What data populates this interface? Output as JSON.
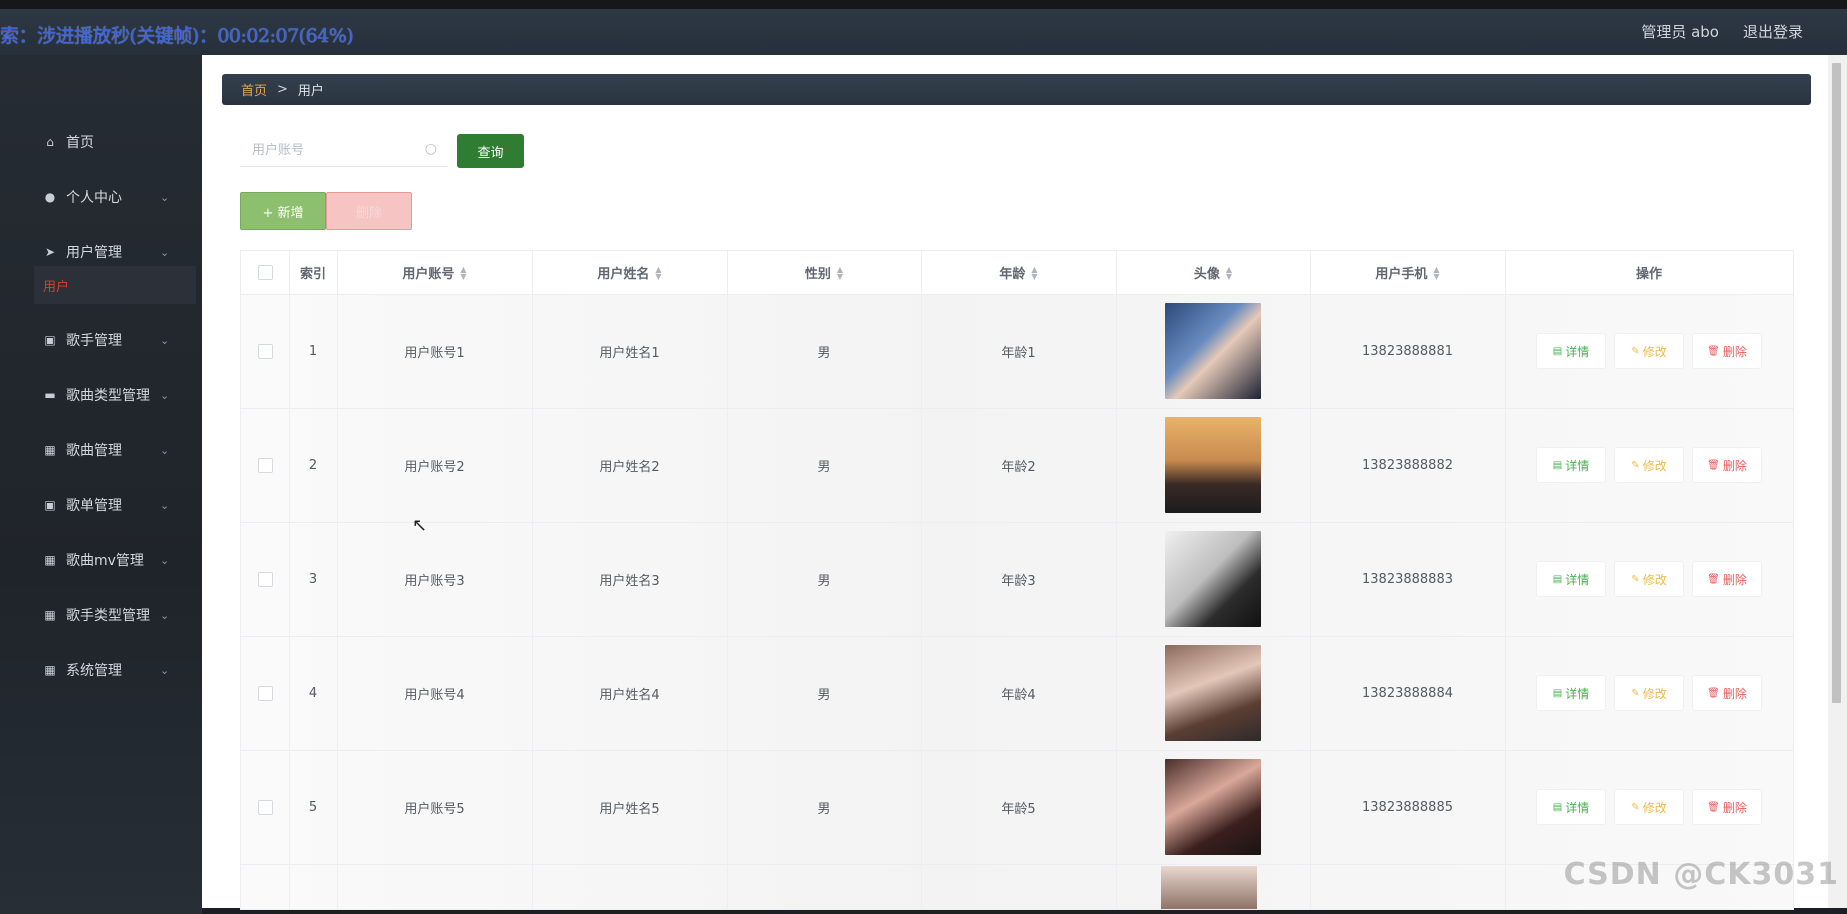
{
  "overlay": {
    "text": "索：涉进播放秒(关键帧)：00:02:07(64%)"
  },
  "header": {
    "user_label": "管理员 abo",
    "logout_label": "退出登录"
  },
  "sidebar": {
    "items": [
      {
        "label": "首页",
        "icon": "home-icon",
        "glyph": "⌂",
        "has_chevron": false
      },
      {
        "label": "个人中心",
        "icon": "user-icon",
        "glyph": "●",
        "has_chevron": true
      },
      {
        "label": "用户管理",
        "icon": "send-icon",
        "glyph": "➤",
        "has_chevron": true
      },
      {
        "label": "歌手管理",
        "icon": "clipboard-icon",
        "glyph": "▣",
        "has_chevron": true
      },
      {
        "label": "歌曲类型管理",
        "icon": "briefcase-icon",
        "glyph": "▬",
        "has_chevron": true
      },
      {
        "label": "歌曲管理",
        "icon": "grid-icon",
        "glyph": "▦",
        "has_chevron": true
      },
      {
        "label": "歌单管理",
        "icon": "clipboard-icon",
        "glyph": "▣",
        "has_chevron": true
      },
      {
        "label": "歌曲mv管理",
        "icon": "grid-icon",
        "glyph": "▦",
        "has_chevron": true
      },
      {
        "label": "歌手类型管理",
        "icon": "grid-icon",
        "glyph": "▦",
        "has_chevron": true
      },
      {
        "label": "系统管理",
        "icon": "grid-icon",
        "glyph": "▦",
        "has_chevron": true
      }
    ],
    "active_sub": "用户"
  },
  "breadcrumb": {
    "home": "首页",
    "separator": ">",
    "current": "用户"
  },
  "search": {
    "placeholder": "用户账号",
    "value": "",
    "button_label": "查询"
  },
  "actions": {
    "add_label": "+ 新增",
    "delete_label": "删除"
  },
  "table": {
    "headers": {
      "index": "索引",
      "account": "用户账号",
      "name": "用户姓名",
      "gender": "性别",
      "age": "年龄",
      "avatar": "头像",
      "phone": "用户手机",
      "ops": "操作"
    },
    "ops": {
      "detail": "详情",
      "edit": "修改",
      "delete": "删除"
    },
    "rows": [
      {
        "index": "1",
        "account": "用户账号1",
        "name": "用户姓名1",
        "gender": "男",
        "age": "年龄1",
        "phone": "13823888881"
      },
      {
        "index": "2",
        "account": "用户账号2",
        "name": "用户姓名2",
        "gender": "男",
        "age": "年龄2",
        "phone": "13823888882"
      },
      {
        "index": "3",
        "account": "用户账号3",
        "name": "用户姓名3",
        "gender": "男",
        "age": "年龄3",
        "phone": "13823888883"
      },
      {
        "index": "4",
        "account": "用户账号4",
        "name": "用户姓名4",
        "gender": "男",
        "age": "年龄4",
        "phone": "13823888884"
      },
      {
        "index": "5",
        "account": "用户账号5",
        "name": "用户姓名5",
        "gender": "男",
        "age": "年龄5",
        "phone": "13823888885"
      }
    ]
  },
  "watermark": "CSDN @CK3031",
  "colors": {
    "accent_green": "#2e7d32",
    "active_menu": "#d4402c",
    "breadcrumb_home": "#e8a64a"
  }
}
